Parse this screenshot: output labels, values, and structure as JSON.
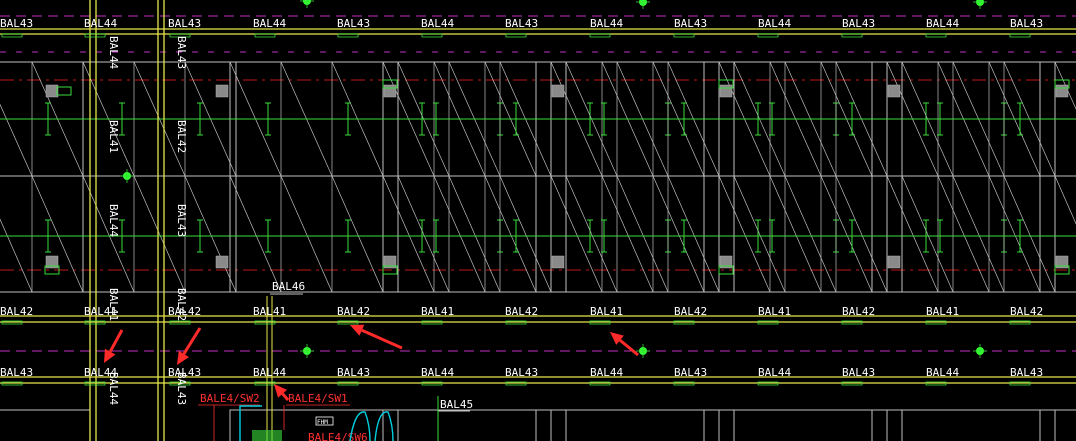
{
  "colors": {
    "background": "#000000",
    "beam_yellow": "#e6e64a",
    "beam_green": "#3adc3a",
    "label_white": "#ffffff",
    "panel_gray": "#c0c0c0",
    "axis_red": "#c01818",
    "magenta": "#c030c0",
    "marker": "#30ff30",
    "arrow_red": "#ff2a2a",
    "pier_gray": "#8a8a8a",
    "cyan": "#00d0e0",
    "red_text": "#ff3030"
  },
  "labels": {
    "row1": [
      "BAL43",
      "BAL44",
      "BAL43",
      "BAL44",
      "BAL43",
      "BAL44",
      "BAL43",
      "BAL44",
      "BAL43",
      "BAL44",
      "BAL43",
      "BAL44",
      "BAL43"
    ],
    "row2": [
      "BAL42",
      "BAL41",
      "BAL42",
      "BAL41",
      "BAL42",
      "BAL41",
      "BAL42",
      "BAL41",
      "BAL42",
      "BAL41",
      "BAL42",
      "BAL41",
      "BAL42"
    ],
    "row3": [
      "BAL43",
      "BAL44",
      "BAL43",
      "BAL44",
      "BAL43",
      "BAL44",
      "BAL43",
      "BAL44",
      "BAL43",
      "BAL44",
      "BAL43",
      "BAL44",
      "BAL43"
    ],
    "col_a": [
      "BAL44",
      "BAL41",
      "BAL44",
      "BAL41",
      "BAL44"
    ],
    "col_b": [
      "BAL43",
      "BAL42",
      "BAL43",
      "BAL42",
      "BAL43"
    ],
    "bal46": "BAL46",
    "bal45": "BAL45",
    "red_sw2": "BALE4/SW2",
    "red_sw1": "BALE4/SW1",
    "red_sw6": "BALE4/SW6",
    "fhm": "FHM"
  }
}
